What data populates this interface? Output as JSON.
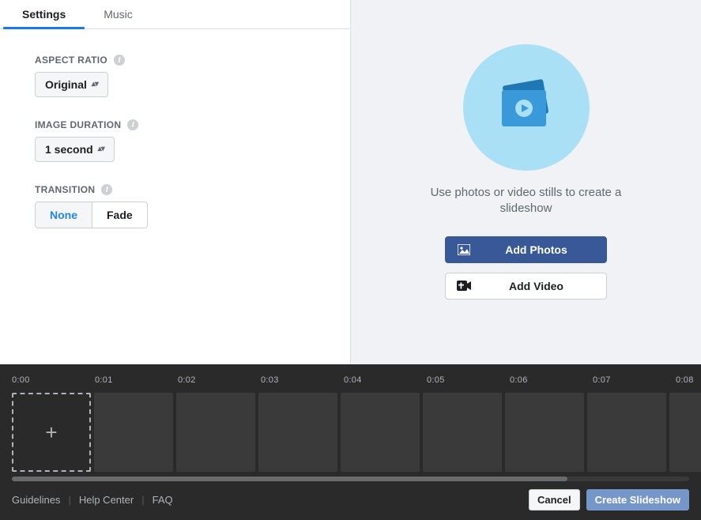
{
  "tabs": {
    "settings": "Settings",
    "music": "Music"
  },
  "settings": {
    "aspect": {
      "label": "ASPECT RATIO",
      "value": "Original"
    },
    "duration": {
      "label": "IMAGE DURATION",
      "value": "1 second"
    },
    "transition": {
      "label": "TRANSITION",
      "none": "None",
      "fade": "Fade"
    }
  },
  "preview": {
    "subtitle": "Use photos or video stills to create a slideshow",
    "add_photos": "Add Photos",
    "add_video": "Add Video"
  },
  "timeline": {
    "ticks": [
      "0:00",
      "0:01",
      "0:02",
      "0:03",
      "0:04",
      "0:05",
      "0:06",
      "0:07",
      "0:08"
    ]
  },
  "footer": {
    "guidelines": "Guidelines",
    "help": "Help Center",
    "faq": "FAQ",
    "cancel": "Cancel",
    "create": "Create Slideshow"
  }
}
